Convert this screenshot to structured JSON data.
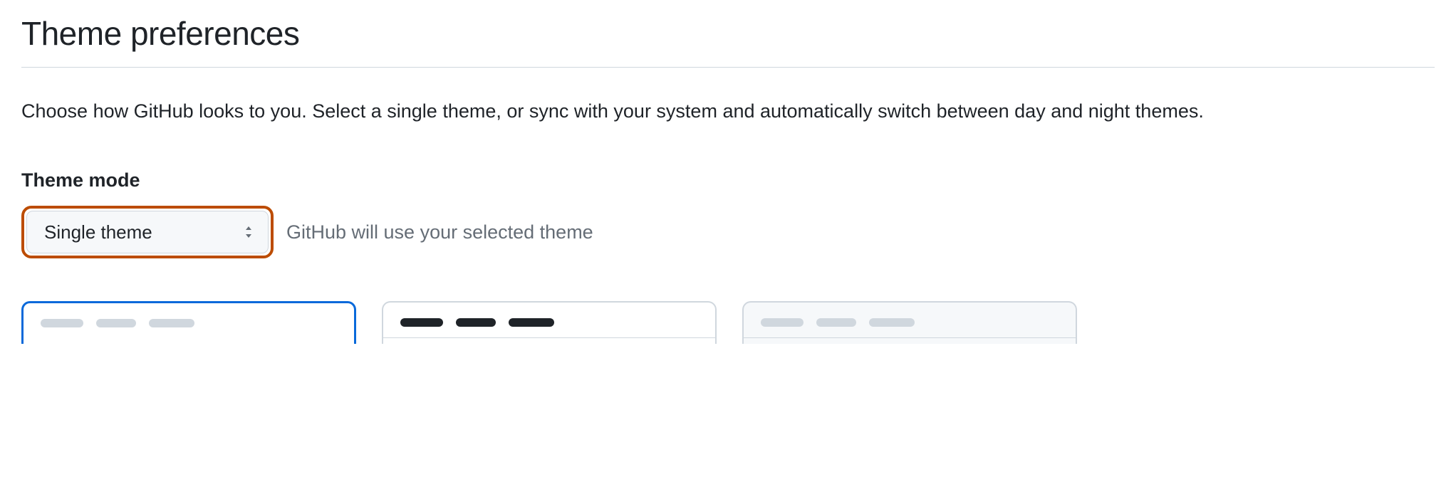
{
  "page": {
    "title": "Theme preferences",
    "description": "Choose how GitHub looks to you. Select a single theme, or sync with your system and automatically switch between day and night themes."
  },
  "theme_mode": {
    "label": "Theme mode",
    "selected": "Single theme",
    "hint": "GitHub will use your selected theme"
  }
}
